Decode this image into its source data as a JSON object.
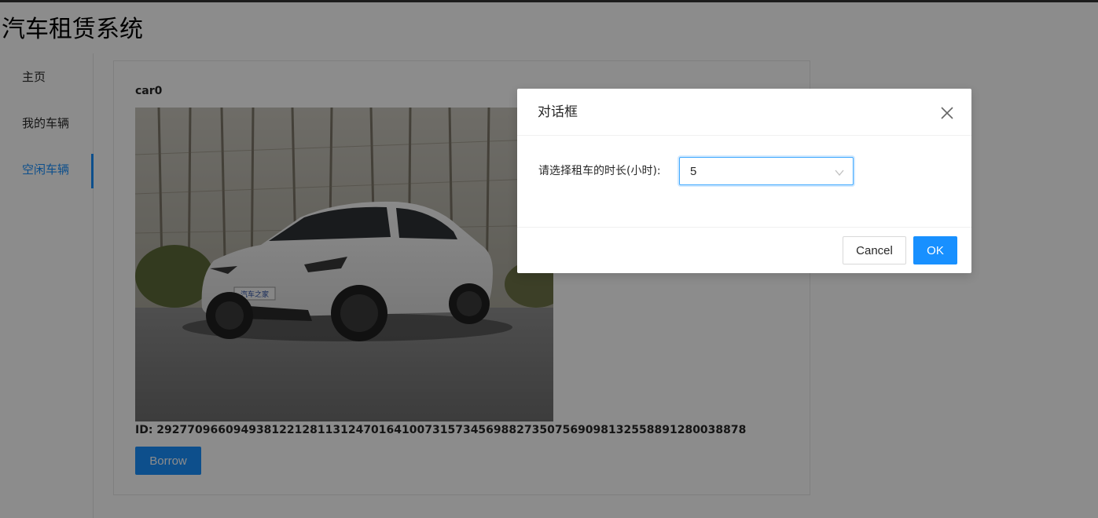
{
  "app": {
    "title": "汽车租赁系统"
  },
  "sidebar": {
    "items": [
      {
        "label": "主页",
        "selected": false
      },
      {
        "label": "我的车辆",
        "selected": false
      },
      {
        "label": "空闲车辆",
        "selected": true
      }
    ]
  },
  "car": {
    "name": "car0",
    "id_text": "ID: 29277096609493812212811312470164100731573456988273507569098132558891280038878",
    "borrow_label": "Borrow",
    "plate_text": "汽车之家"
  },
  "dialog": {
    "title": "对话框",
    "field_label": "请选择租车的时长(小时):",
    "selected_value": "5",
    "cancel_label": "Cancel",
    "ok_label": "OK"
  },
  "icons": {
    "close": "close-icon",
    "dropdown": "chevron-down-icon"
  },
  "colors": {
    "primary": "#1890ff",
    "mask": "rgba(0,0,0,0.45)"
  }
}
